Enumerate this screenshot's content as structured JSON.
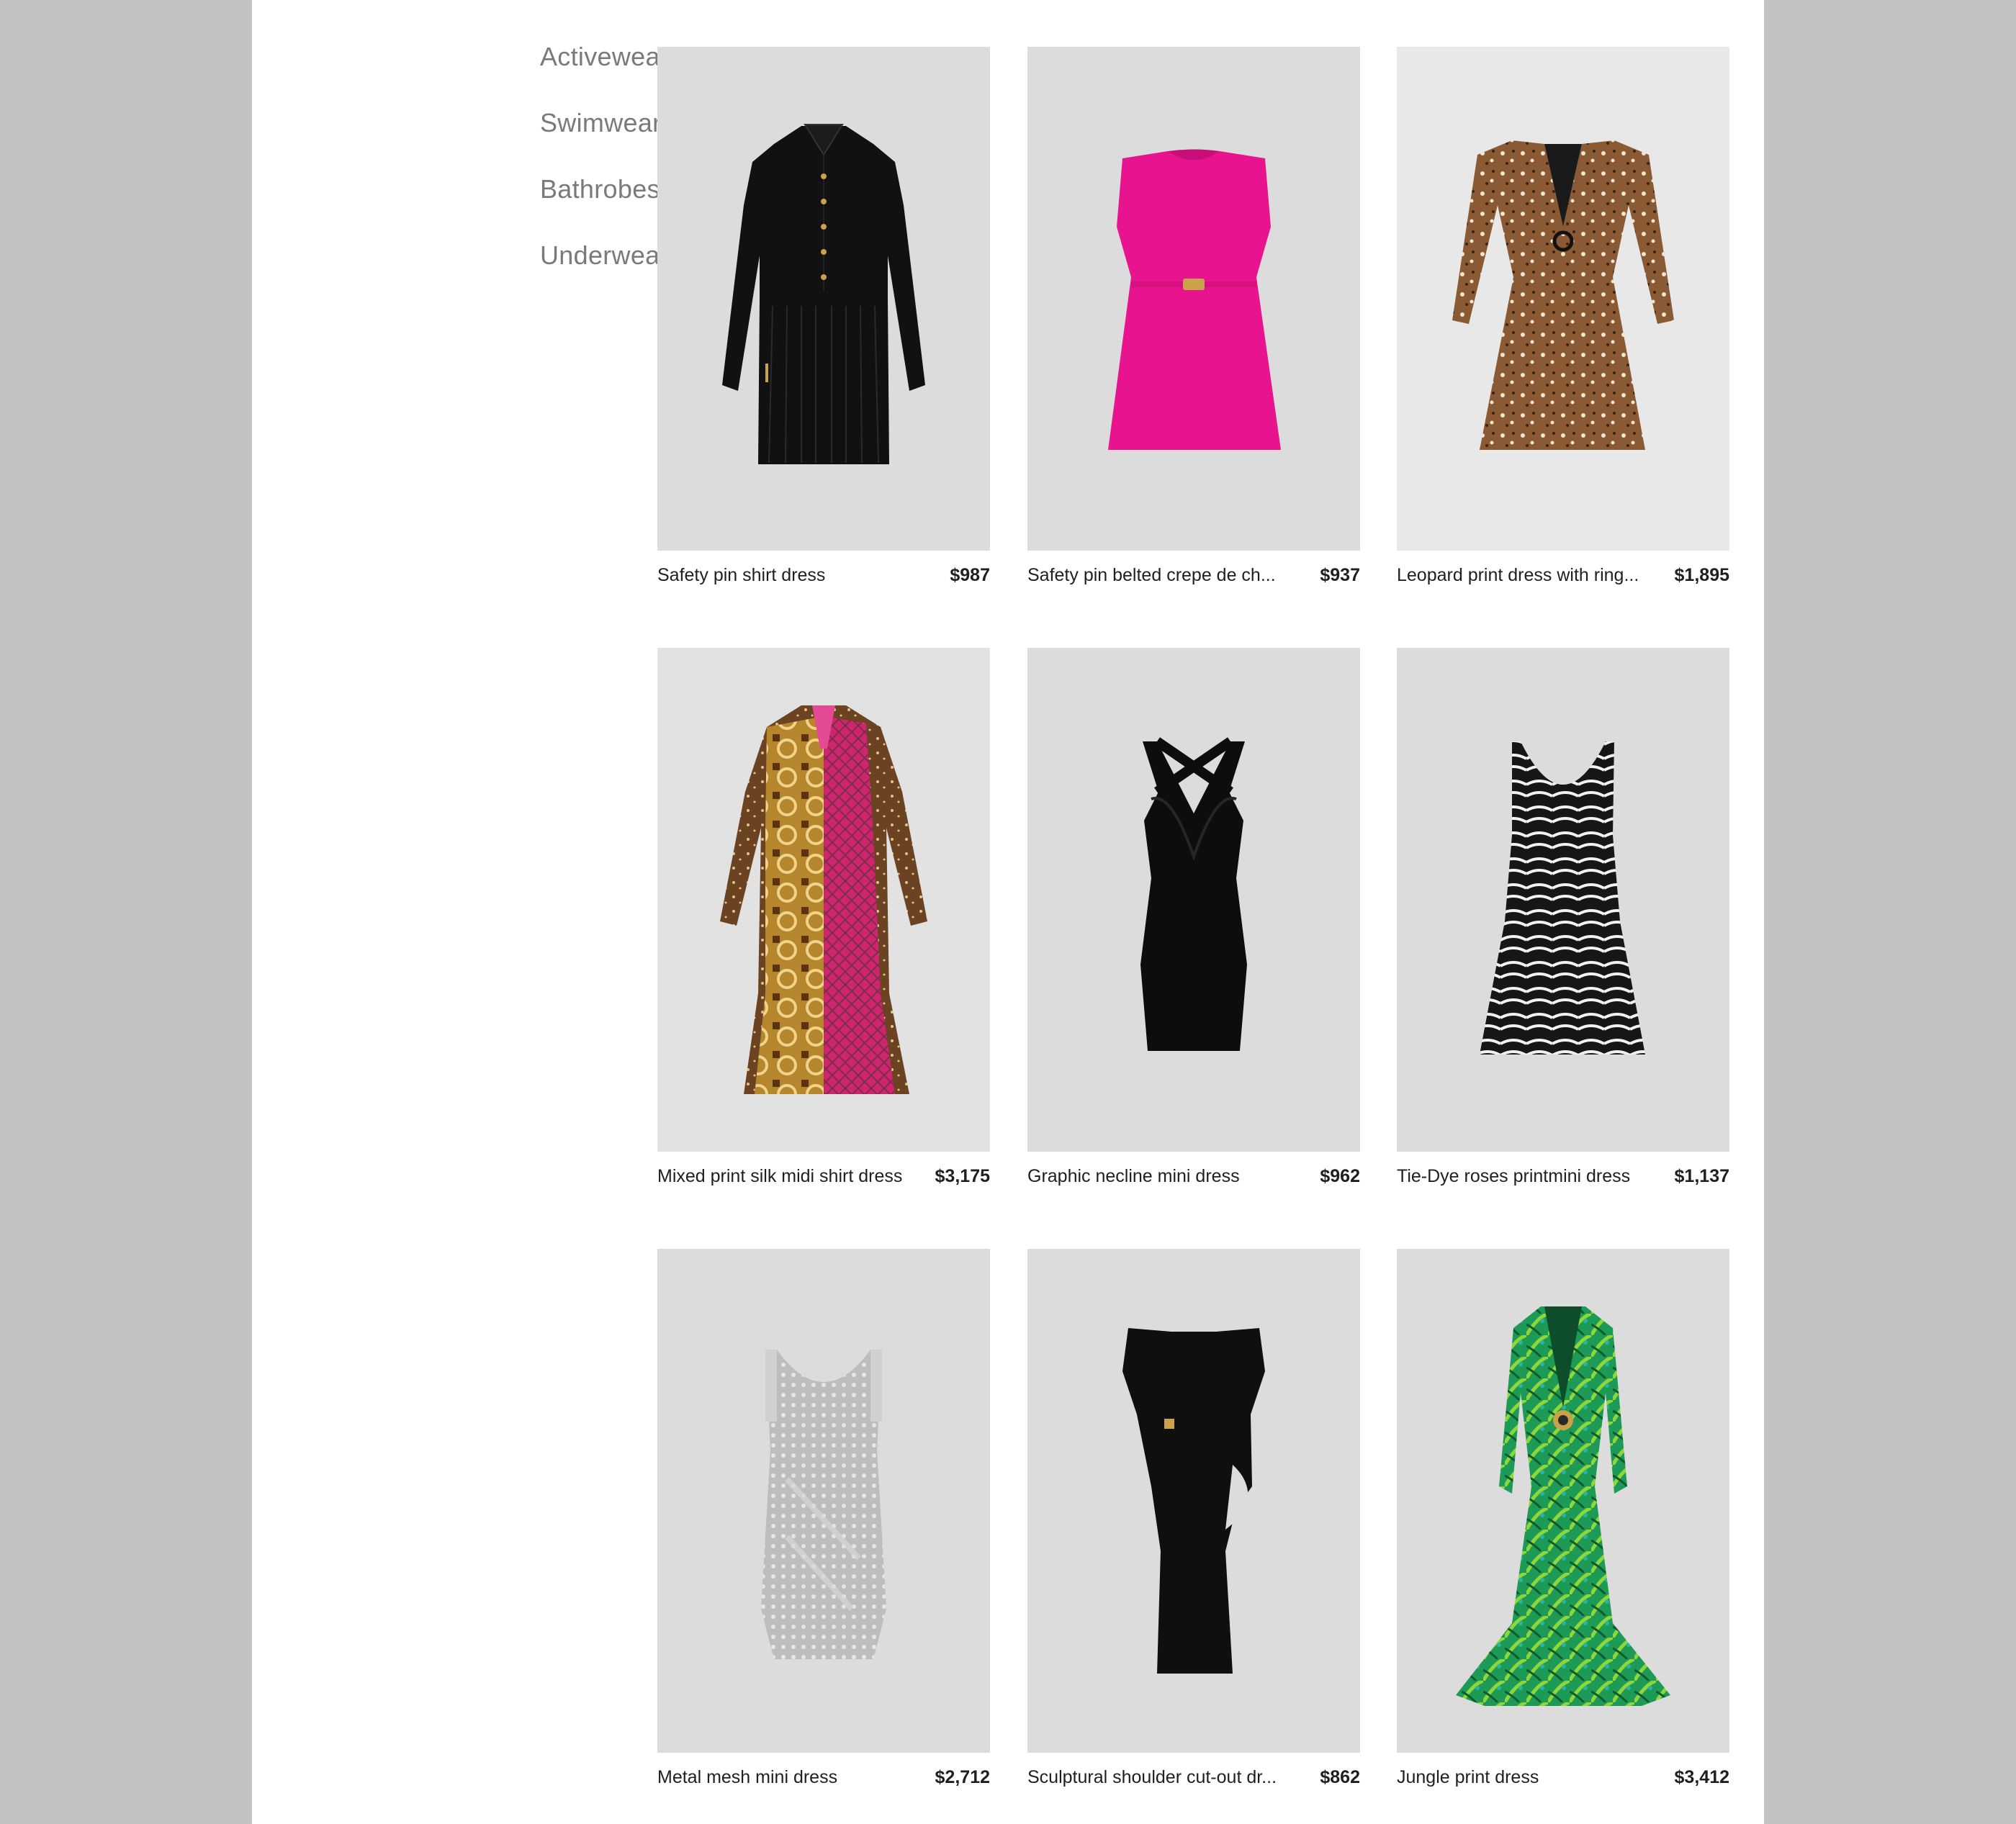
{
  "sidebar": {
    "items": [
      {
        "label": "Activewear"
      },
      {
        "label": "Swimwear"
      },
      {
        "label": "Bathrobes"
      },
      {
        "label": "Underwear & Socks"
      }
    ]
  },
  "products": [
    {
      "name": "Safety pin shirt dress",
      "price": "$987",
      "image": "black-shirt-dress"
    },
    {
      "name": "Safety pin belted crepe de ch...",
      "price": "$937",
      "image": "pink-belted-dress"
    },
    {
      "name": "Leopard print dress with ring...",
      "price": "$1,895",
      "image": "leopard-dress"
    },
    {
      "name": "Mixed print silk midi shirt dress",
      "price": "$3,175",
      "image": "mixed-print-dress"
    },
    {
      "name": "Graphic necline mini dress",
      "price": "$962",
      "image": "black-mini-dress"
    },
    {
      "name": "Tie-Dye  roses printmini dress",
      "price": "$1,137",
      "image": "zebra-print-dress"
    },
    {
      "name": "Metal mesh mini dress",
      "price": "$2,712",
      "image": "silver-mesh-dress"
    },
    {
      "name": "Sculptural shoulder cut-out dr...",
      "price": "$862",
      "image": "black-cutout-dress"
    },
    {
      "name": "Jungle print dress",
      "price": "$3,412",
      "image": "jungle-print-dress"
    }
  ],
  "colors": {
    "page_bg": "#c2c2c2",
    "content_bg": "#ffffff",
    "image_bg": "#dcdcdc",
    "sidebar_text": "#7a7a7a",
    "product_text": "#1f1f1f"
  }
}
